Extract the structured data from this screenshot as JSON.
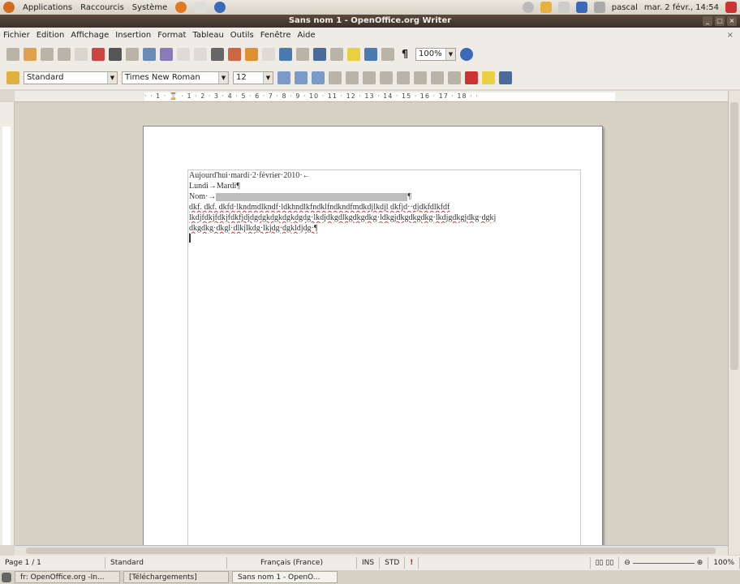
{
  "top_panel": {
    "menus": [
      "Applications",
      "Raccourcis",
      "Système"
    ],
    "user": "pascal",
    "clock": "mar. 2 févr., 14:54"
  },
  "window": {
    "title": "Sans nom 1 - OpenOffice.org Writer"
  },
  "menubar": [
    "Fichier",
    "Edition",
    "Affichage",
    "Insertion",
    "Format",
    "Tableau",
    "Outils",
    "Fenêtre",
    "Aide"
  ],
  "toolbar": {
    "zoom": "100%",
    "style": "Standard",
    "font": "Times New Roman",
    "size": "12"
  },
  "ruler": {
    "marks": "· · 1 · ⌛ · 1 · 2 · 3 · 4 · 5 · 6 · 7 · 8 · 9 · 10 · 11 · 12 · 13 · 14 · 15 · 16 · 17 · 18 · ·"
  },
  "document": {
    "lines": [
      "Aujourd'hui·mardi·2·février·2010·←",
      "Lundi→Mardi¶",
      "Nom·→",
      "dkf. dkf. dkfd·lkndmdlkndf·ldkhndlkfndklfndkndfmdkdjlkdjl dkfjd··djdkfdlkfdf",
      "lkdjfdkjfdkjfdkfjdjdgdgkdgkdgkdgdg·lkdjdkgdlkgdkgdkg·ldkgjdkgdkgdkg·lkdjgdkgjdkg·dgkj",
      "dkgdkg·dkgl·dlkjlkdg·lkjdg·dgkldjdg·¶"
    ]
  },
  "status": {
    "page": "Page 1 / 1",
    "style": "Standard",
    "language": "Français (France)",
    "mode": "INS",
    "selection": "STD",
    "zoom": "100%"
  },
  "taskbar": [
    "fr: OpenOffice.org -In...",
    "[Téléchargements]",
    "Sans nom 1 - OpenO..."
  ]
}
